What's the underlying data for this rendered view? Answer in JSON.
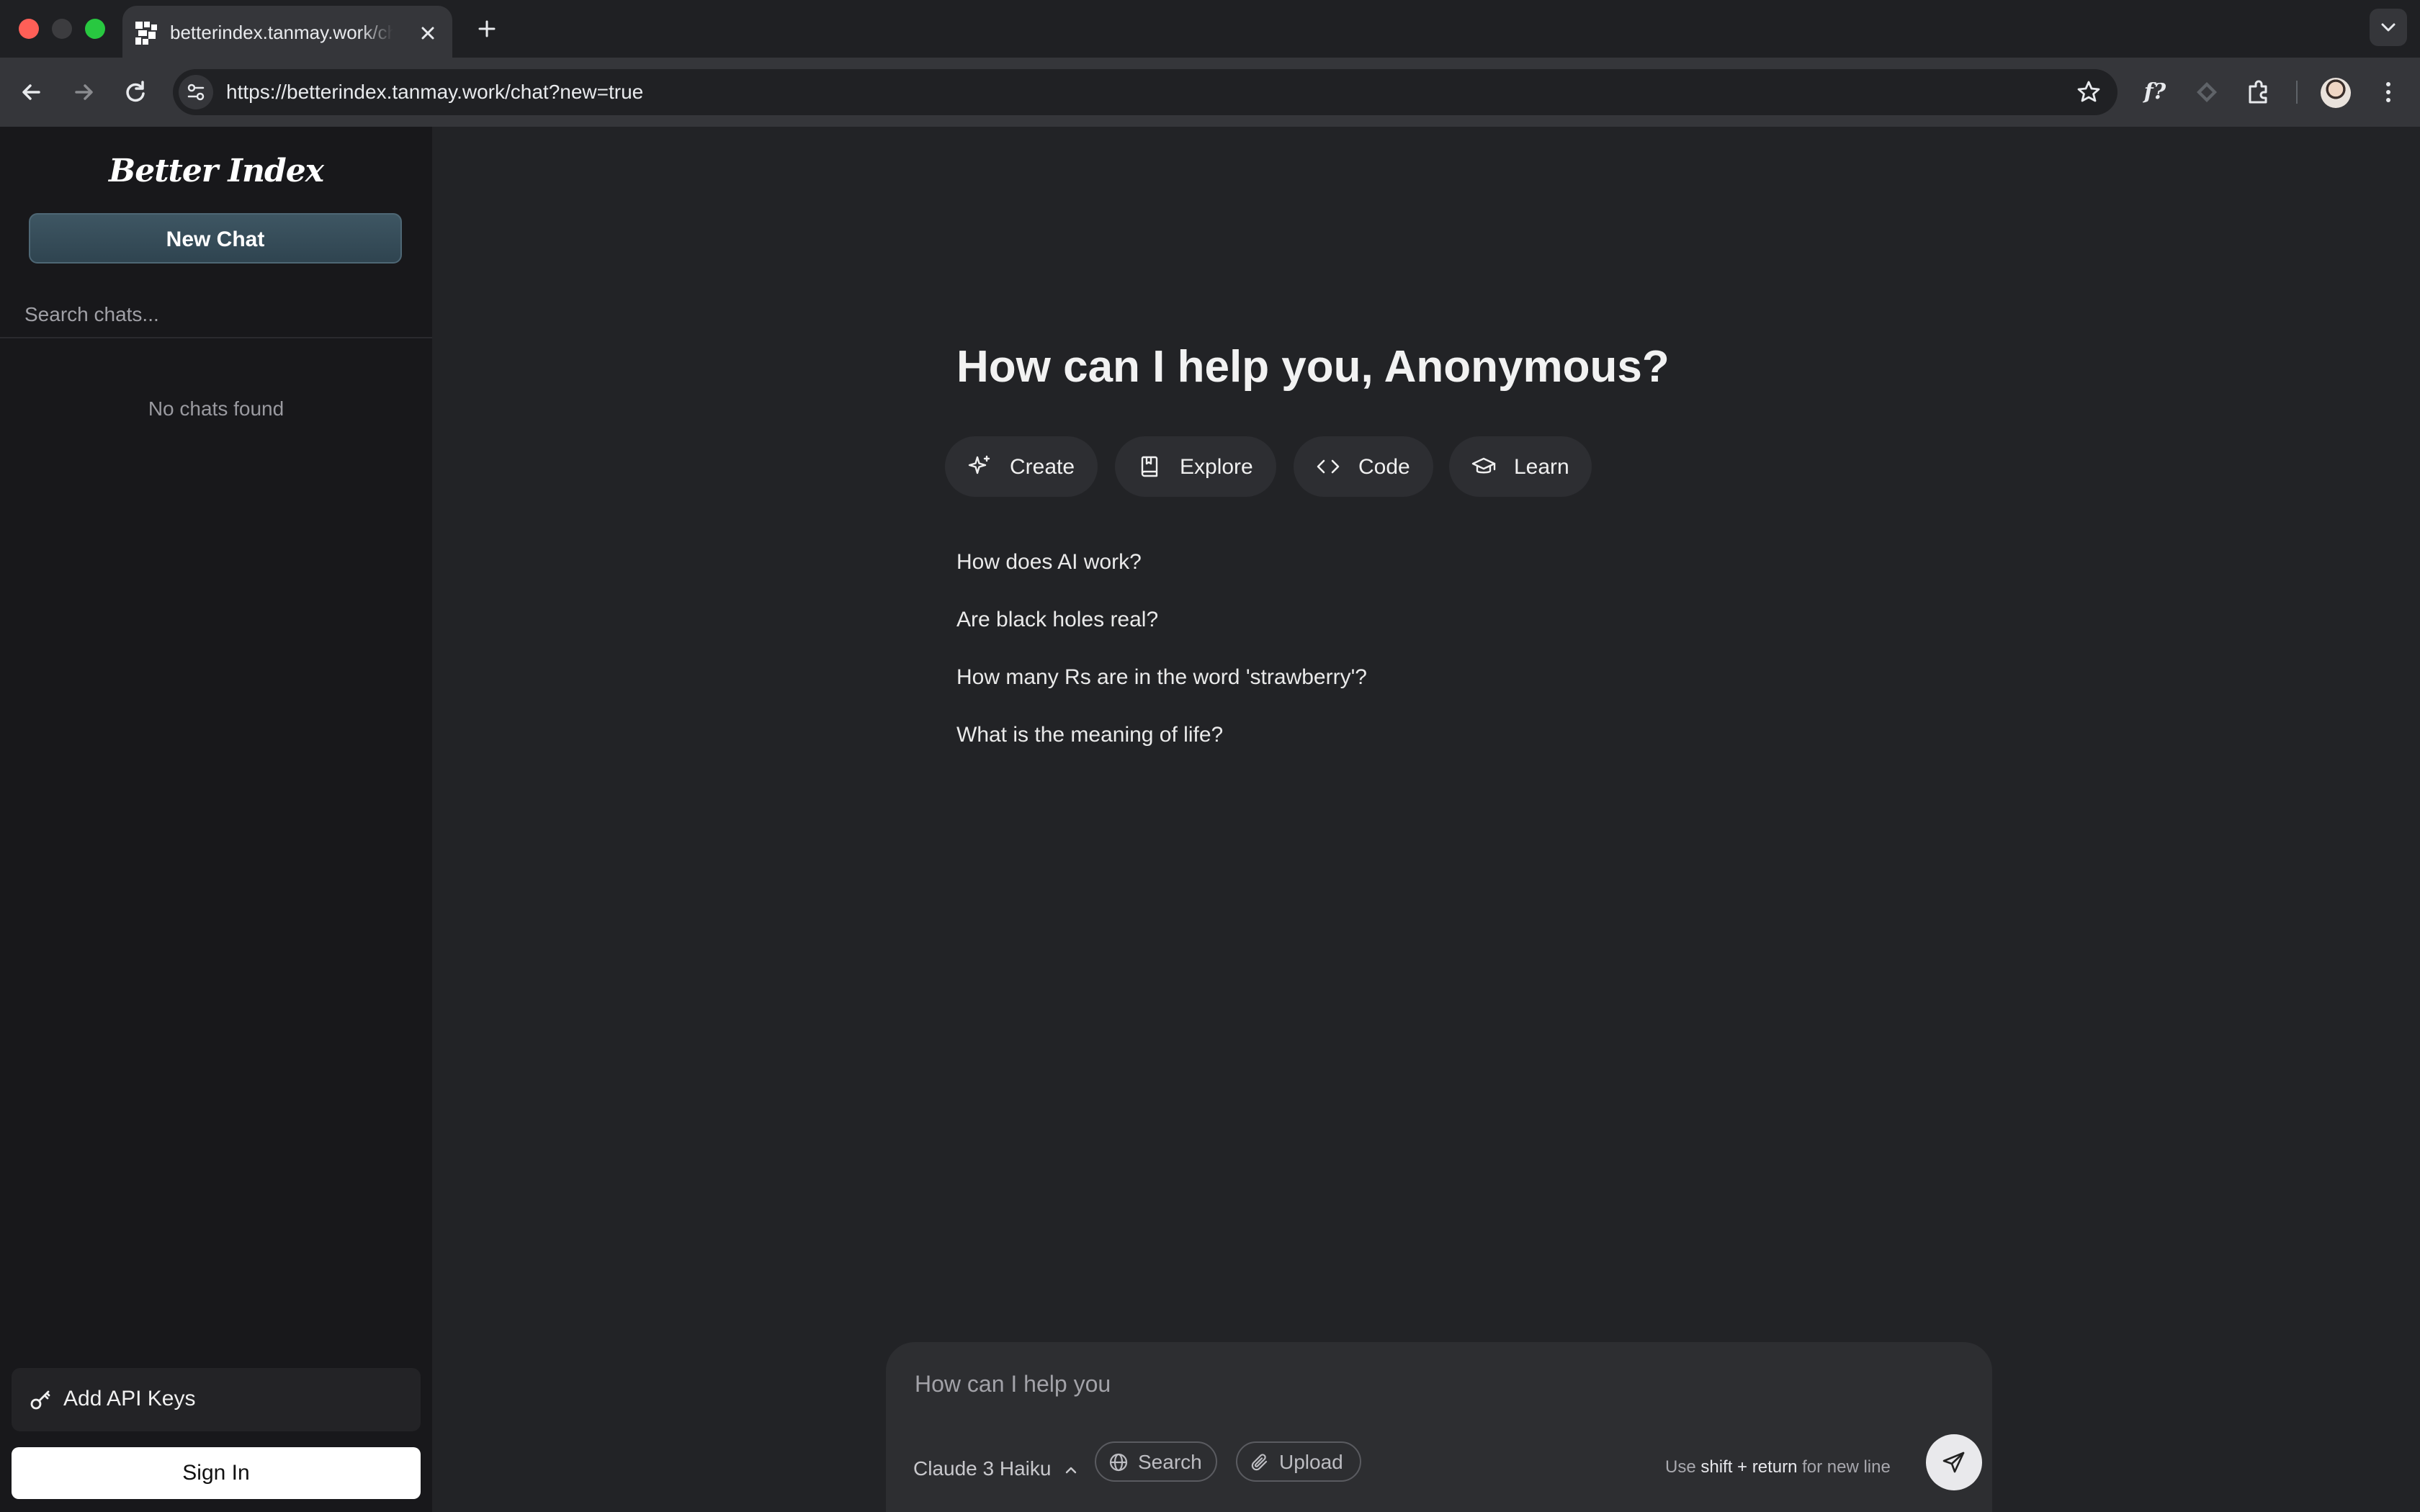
{
  "browser": {
    "tab_title": "betterindex.tanmay.work/chat?new=true",
    "url": "https://betterindex.tanmay.work/chat?new=true",
    "extension_label": "f?",
    "icons": [
      "back-icon",
      "forward-icon",
      "reload-icon",
      "site-info-icon",
      "star-icon",
      "extensions-icon",
      "menu-icon"
    ]
  },
  "sidebar": {
    "brand": "Better Index",
    "new_chat_label": "New Chat",
    "search_placeholder": "Search chats...",
    "empty_text": "No chats found",
    "api_keys_label": "Add API Keys",
    "sign_in_label": "Sign In"
  },
  "main": {
    "greeting": "How can I help you, Anonymous?",
    "categories": [
      {
        "label": "Create",
        "icon": "sparkles-icon"
      },
      {
        "label": "Explore",
        "icon": "book-icon"
      },
      {
        "label": "Code",
        "icon": "code-icon"
      },
      {
        "label": "Learn",
        "icon": "graduation-cap-icon"
      }
    ],
    "suggestions": [
      "How does AI work?",
      "Are black holes real?",
      "How many Rs are in the word 'strawberry'?",
      "What is the meaning of life?"
    ]
  },
  "composer": {
    "placeholder": "How can I help you",
    "model": "Claude 3 Haiku",
    "search_label": "Search",
    "upload_label": "Upload",
    "hint_prefix": "Use",
    "hint_keys": "shift + return",
    "hint_suffix": "for new line"
  },
  "colors": {
    "page_bg": "#222326",
    "sidebar_bg": "#18181b",
    "new_chat_bg": "#3e5663",
    "chip_bg": "#2d2e32"
  }
}
